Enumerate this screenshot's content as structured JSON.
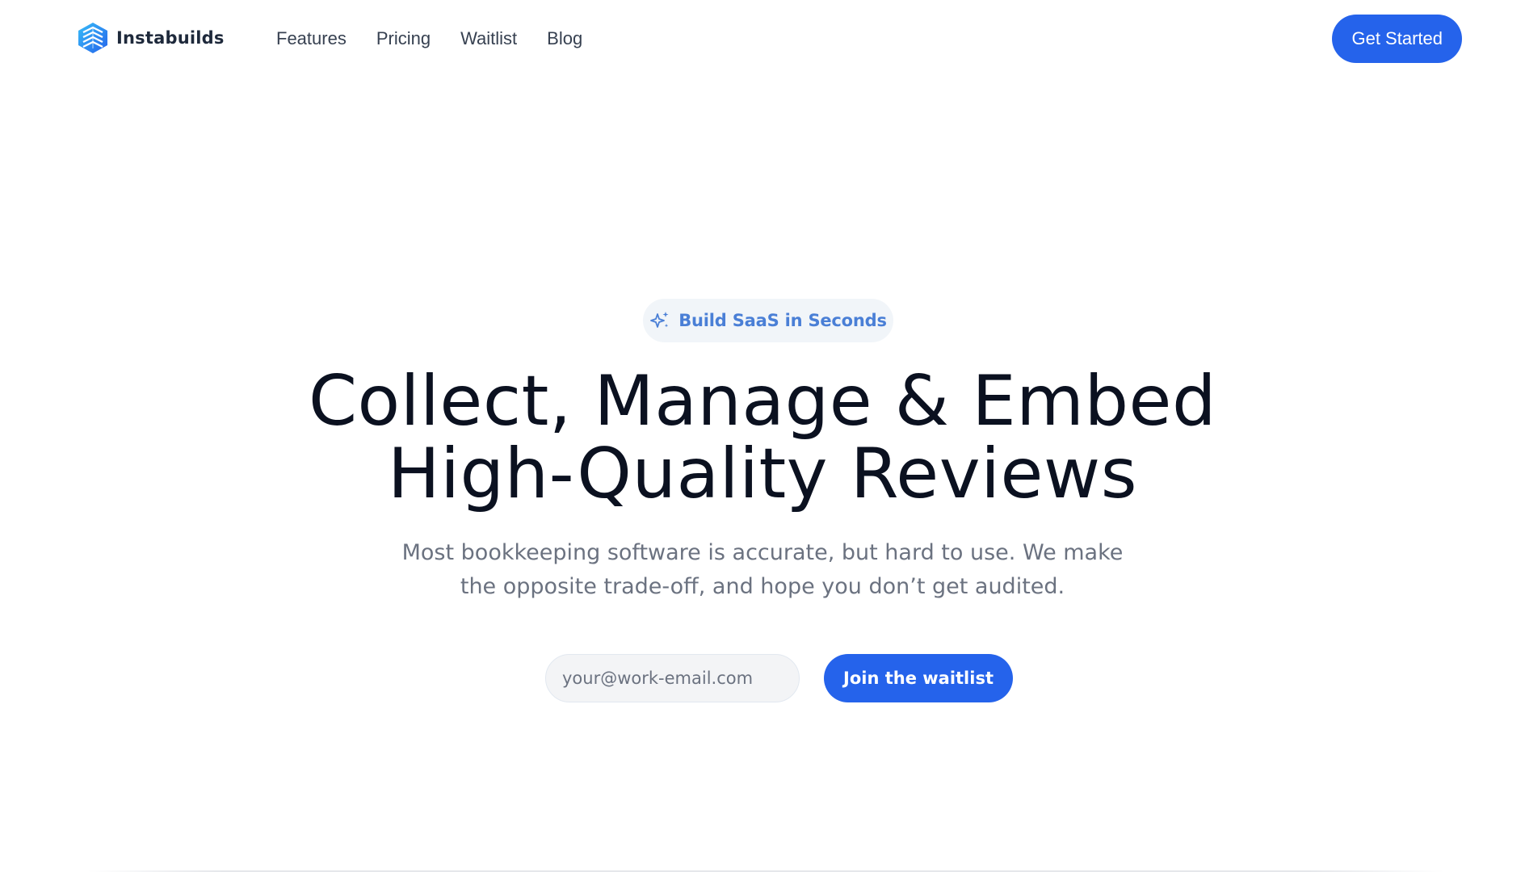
{
  "brand": {
    "name": "Instabuilds",
    "logo_icon": "layered-diamond-logo"
  },
  "nav": {
    "links": [
      "Features",
      "Pricing",
      "Waitlist",
      "Blog"
    ],
    "cta_label": "Get Started"
  },
  "hero": {
    "badge": {
      "icon": "sparkles-icon",
      "label": "Build SaaS in Seconds"
    },
    "title_line1": "Collect, Manage & Embed",
    "title_line2": "High-Quality Reviews",
    "subtitle": "Most bookkeeping software is accurate, but hard to use. We make the opposite trade-off, and hope you don’t get audited.",
    "email_placeholder": "your@work-email.com",
    "join_label": "Join the waitlist"
  },
  "colors": {
    "accent": "#2563eb",
    "badge_text": "#4a7fd6",
    "badge_bg": "#f1f5f9",
    "title": "#0b1120",
    "subtitle": "#6b7280"
  }
}
